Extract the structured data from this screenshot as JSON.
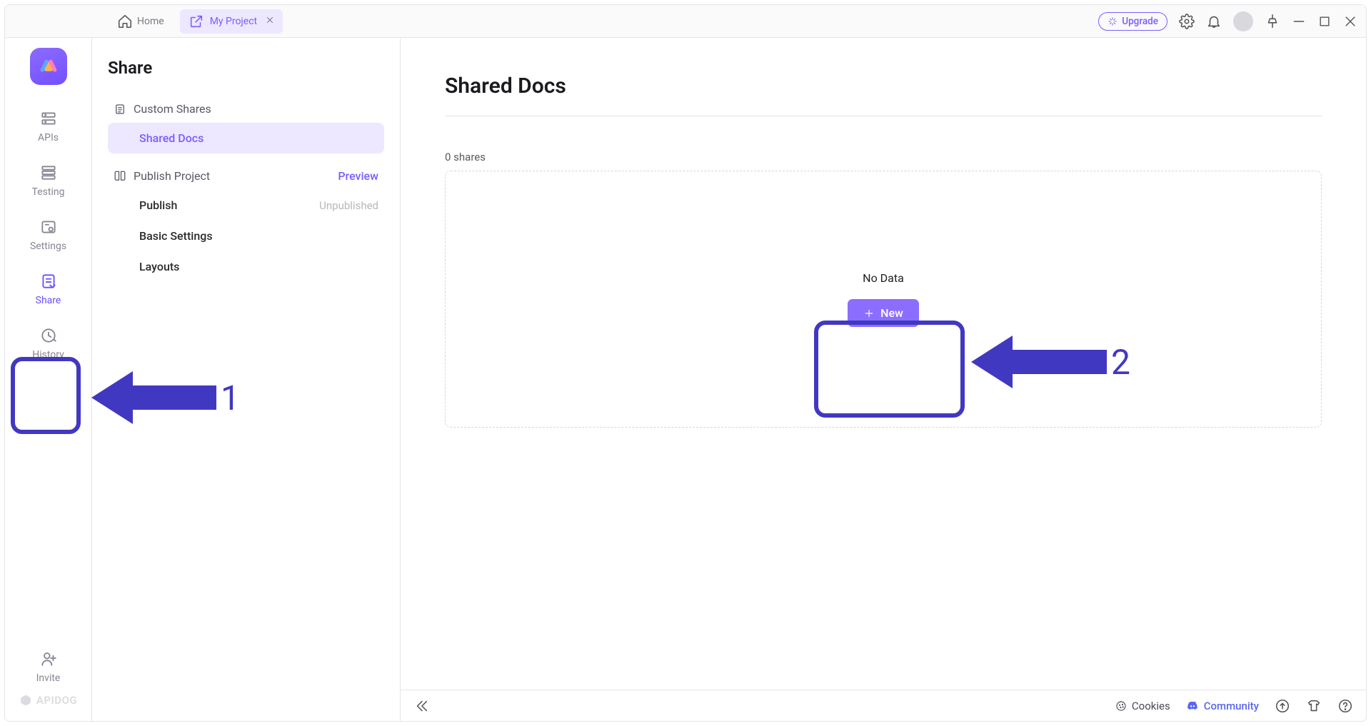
{
  "titlebar": {
    "home_label": "Home",
    "tab_label": "My Project",
    "upgrade_label": "Upgrade"
  },
  "rail": {
    "apis": "APIs",
    "testing": "Testing",
    "settings": "Settings",
    "share": "Share",
    "history": "History",
    "invite": "Invite",
    "brand": "APIDOG"
  },
  "sidebar": {
    "title": "Share",
    "custom_shares_label": "Custom Shares",
    "shared_docs_label": "Shared Docs",
    "publish_project_label": "Publish Project",
    "preview_label": "Preview",
    "publish_label": "Publish",
    "publish_status": "Unpublished",
    "basic_settings_label": "Basic Settings",
    "layouts_label": "Layouts"
  },
  "main": {
    "title": "Shared Docs",
    "shares_count": "0 shares",
    "no_data_label": "No Data",
    "new_button_label": "New"
  },
  "bottombar": {
    "cookies_label": "Cookies",
    "community_label": "Community"
  },
  "annotations": {
    "one": "1",
    "two": "2"
  }
}
